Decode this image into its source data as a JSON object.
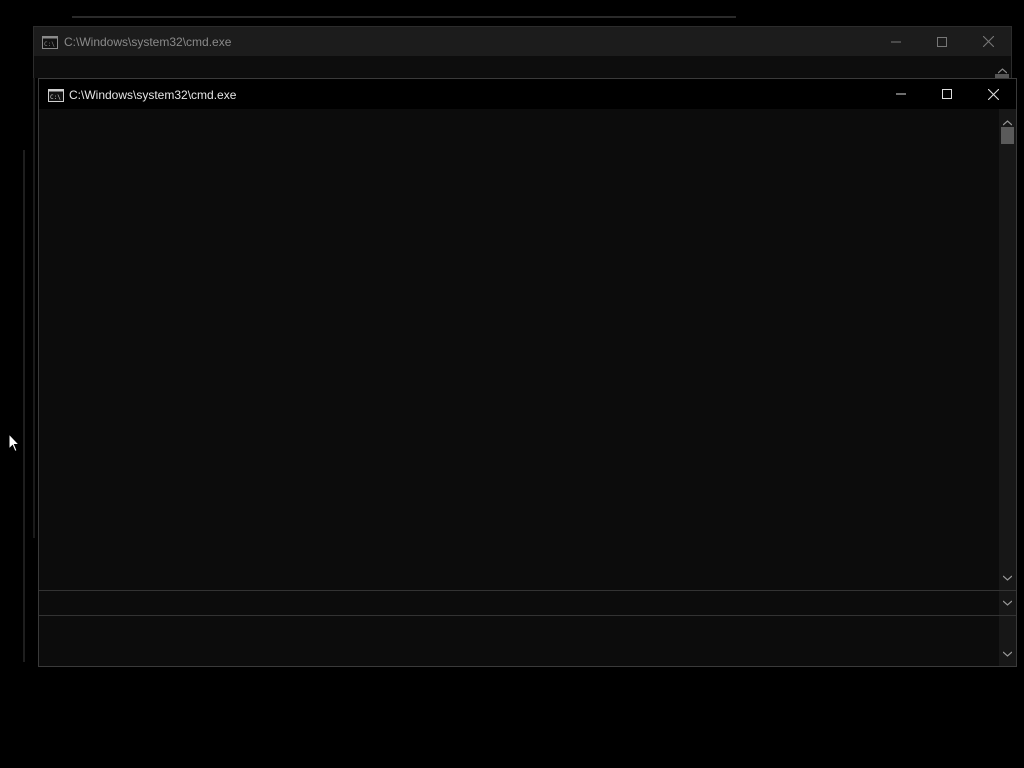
{
  "back_window": {
    "title": "C:\\Windows\\system32\\cmd.exe",
    "icon": "cmd-icon",
    "controls": [
      "minimize-icon",
      "maximize-icon",
      "close-icon"
    ]
  },
  "front_window": {
    "title": "C:\\Windows\\system32\\cmd.exe",
    "icon": "cmd-icon",
    "controls": [
      "minimize-icon",
      "maximize-icon",
      "close-icon"
    ],
    "console_text": ""
  },
  "colors": {
    "desktop": "#000000",
    "console_bg": "#0c0c0c",
    "titlebar_active": "#000000",
    "titlebar_inactive": "#1c1c1c",
    "title_text_active": "#e6e6e6",
    "title_text_inactive": "#8a8a8a"
  }
}
